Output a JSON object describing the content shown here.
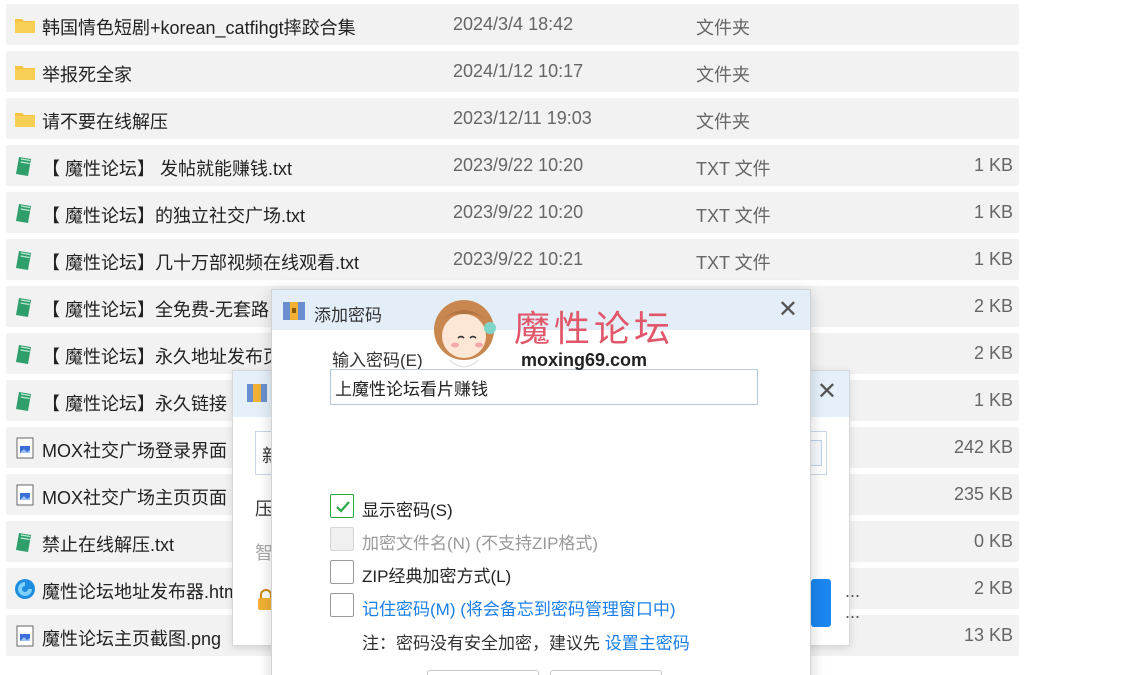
{
  "file_list": {
    "columns": [
      "name",
      "date",
      "type",
      "size"
    ],
    "rows": [
      {
        "icon": "folder-icon",
        "name": "韩国情色短剧+korean_catfihgt摔跤合集",
        "date": "2024/3/4 18:42",
        "type": "文件夹",
        "size": ""
      },
      {
        "icon": "folder-icon",
        "name": "举报死全家",
        "date": "2024/1/12 10:17",
        "type": "文件夹",
        "size": ""
      },
      {
        "icon": "folder-icon",
        "name": "请不要在线解压",
        "date": "2023/12/11 19:03",
        "type": "文件夹",
        "size": ""
      },
      {
        "icon": "txt-file-icon",
        "name": "【 魔性论坛】 发帖就能赚钱.txt",
        "date": "2023/9/22 10:20",
        "type": "TXT 文件",
        "size": "1 KB"
      },
      {
        "icon": "txt-file-icon",
        "name": "【 魔性论坛】的独立社交广场.txt",
        "date": "2023/9/22 10:20",
        "type": "TXT 文件",
        "size": "1 KB"
      },
      {
        "icon": "txt-file-icon",
        "name": "【 魔性论坛】几十万部视频在线观看.txt",
        "date": "2023/9/22 10:21",
        "type": "TXT 文件",
        "size": "1 KB"
      },
      {
        "icon": "txt-file-icon",
        "name": "【 魔性论坛】全免费-无套路",
        "date": "",
        "type": "",
        "size": "2 KB"
      },
      {
        "icon": "txt-file-icon",
        "name": "【 魔性论坛】永久地址发布页",
        "date": "",
        "type": "",
        "size": "2 KB"
      },
      {
        "icon": "txt-file-icon",
        "name": "【 魔性论坛】永久链接",
        "date": "",
        "type": "",
        "size": "1 KB"
      },
      {
        "icon": "image-file-icon",
        "name": "MOX社交广场登录界面",
        "date": "",
        "type": "",
        "size": "242 KB"
      },
      {
        "icon": "image-file-icon",
        "name": "MOX社交广场主页页面",
        "date": "",
        "type": "",
        "size": "235 KB"
      },
      {
        "icon": "txt-file-icon",
        "name": "禁止在线解压.txt",
        "date": "",
        "type": "",
        "size": "0 KB"
      },
      {
        "icon": "browser-file-icon",
        "name": "魔性论坛地址发布器.htm",
        "date": "",
        "type": "",
        "size": "2 KB"
      },
      {
        "icon": "image-file-icon",
        "name": "魔性论坛主页截图.png",
        "date": "",
        "type": "",
        "size": "13 KB"
      }
    ]
  },
  "back_dialog": {
    "field_text": "新",
    "label1": "压",
    "label2": "智",
    "more": "... ...",
    "close": "✕"
  },
  "dialog": {
    "title": "添加密码",
    "close": "✕",
    "password_label": "输入密码(E)",
    "password_value": "上魔性论坛看片赚钱",
    "show_password": {
      "label": "显示密码(S)",
      "checked": true
    },
    "encrypt_names": {
      "label": "加密文件名(N) (不支持ZIP格式)",
      "checked": false,
      "disabled": true
    },
    "zip_classic": {
      "label": "ZIP经典加密方式(L)",
      "checked": false
    },
    "remember": {
      "label": "记住密码(M)",
      "hint": "(将会备忘到密码管理窗口中)",
      "checked": false
    },
    "note_prefix": "注：密码没有安全加密，建议先",
    "note_link": "设置主密码"
  },
  "watermark": {
    "title": "魔性论坛",
    "url": "moxing69.com"
  },
  "colors": {
    "row_bg": "#f2f2f2",
    "folder": "#f5c242",
    "accent_blue": "#1a7fe8",
    "check_green": "#28a745",
    "brand_pink": "#e2566a"
  }
}
